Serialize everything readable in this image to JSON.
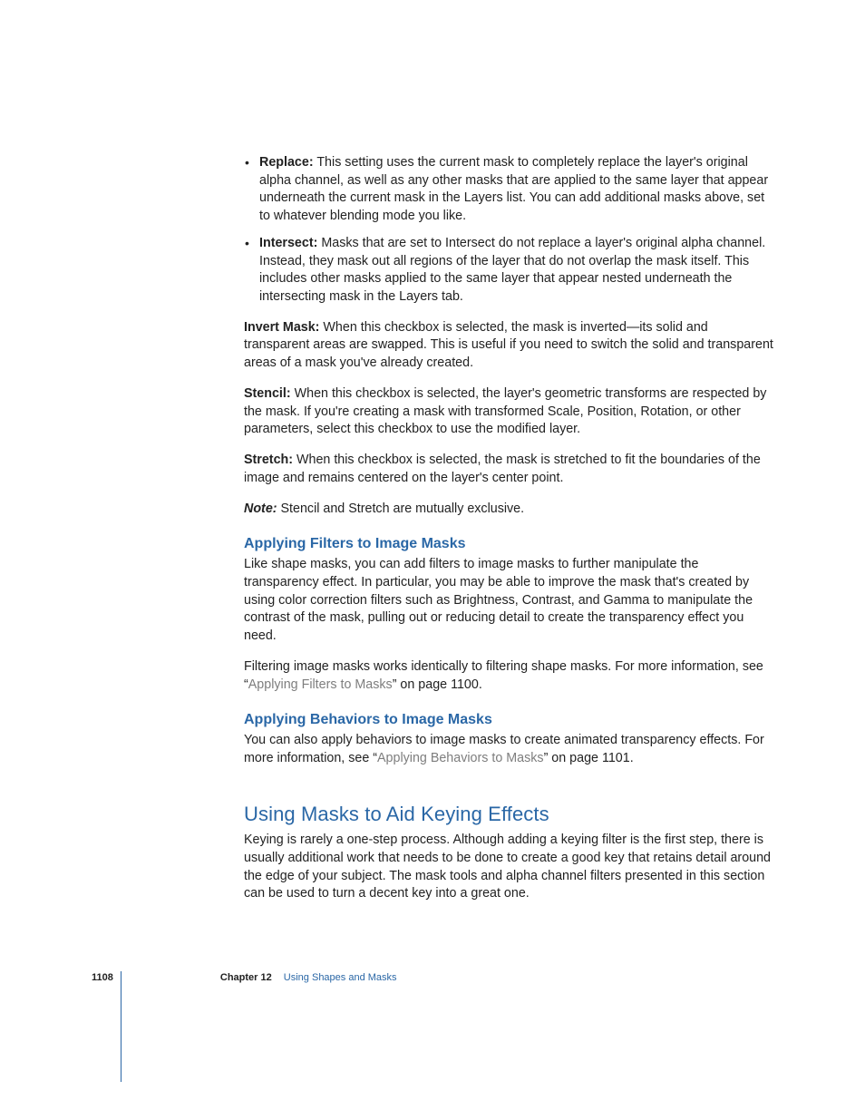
{
  "bullets": [
    {
      "term": "Replace:",
      "text": "This setting uses the current mask to completely replace the layer's original alpha channel, as well as any other masks that are applied to the same layer that appear underneath the current mask in the Layers list. You can add additional masks above, set to whatever blending mode you like."
    },
    {
      "term": "Intersect:",
      "text": "Masks that are set to Intersect do not replace a layer's original alpha channel. Instead, they mask out all regions of the layer that do not overlap the mask itself. This includes other masks applied to the same layer that appear nested underneath the intersecting mask in the Layers tab."
    }
  ],
  "paras": {
    "invert": {
      "term": "Invert Mask:",
      "text": "When this checkbox is selected, the mask is inverted—its solid and transparent areas are swapped. This is useful if you need to switch the solid and transparent areas of a mask you've already created."
    },
    "stencil": {
      "term": "Stencil:",
      "text": "When this checkbox is selected, the layer's geometric transforms are respected by the mask. If you're creating a mask with transformed Scale, Position, Rotation, or other parameters, select this checkbox to use the modified layer."
    },
    "stretch": {
      "term": "Stretch:",
      "text": "When this checkbox is selected, the mask is stretched to fit the boundaries of the image and remains centered on the layer's center point."
    },
    "note": {
      "label": "Note:",
      "text": "Stencil and Stretch are mutually exclusive."
    }
  },
  "filters": {
    "heading": "Applying Filters to Image Masks",
    "p1": "Like shape masks, you can add filters to image masks to further manipulate the transparency effect. In particular, you may be able to improve the mask that's created by using color correction filters such as Brightness, Contrast, and Gamma to manipulate the contrast of the mask, pulling out or reducing detail to create the transparency effect you need.",
    "p2_pre": "Filtering image masks works identically to filtering shape masks. For more information, see “",
    "p2_link": "Applying Filters to Masks",
    "p2_post": "” on page 1100."
  },
  "behaviors": {
    "heading": "Applying Behaviors to Image Masks",
    "p_pre": "You can also apply behaviors to image masks to create animated transparency effects. For more information, see “",
    "p_link": "Applying Behaviors to Masks",
    "p_post": "” on page 1101."
  },
  "keying": {
    "heading": "Using Masks to Aid Keying Effects",
    "p": "Keying is rarely a one-step process. Although adding a keying filter is the first step, there is usually additional work that needs to be done to create a good key that retains detail around the edge of your subject. The mask tools and alpha channel filters presented in this section can be used to turn a decent key into a great one."
  },
  "footer": {
    "page": "1108",
    "chapter_label": "Chapter 12",
    "chapter_title": "Using Shapes and Masks"
  }
}
